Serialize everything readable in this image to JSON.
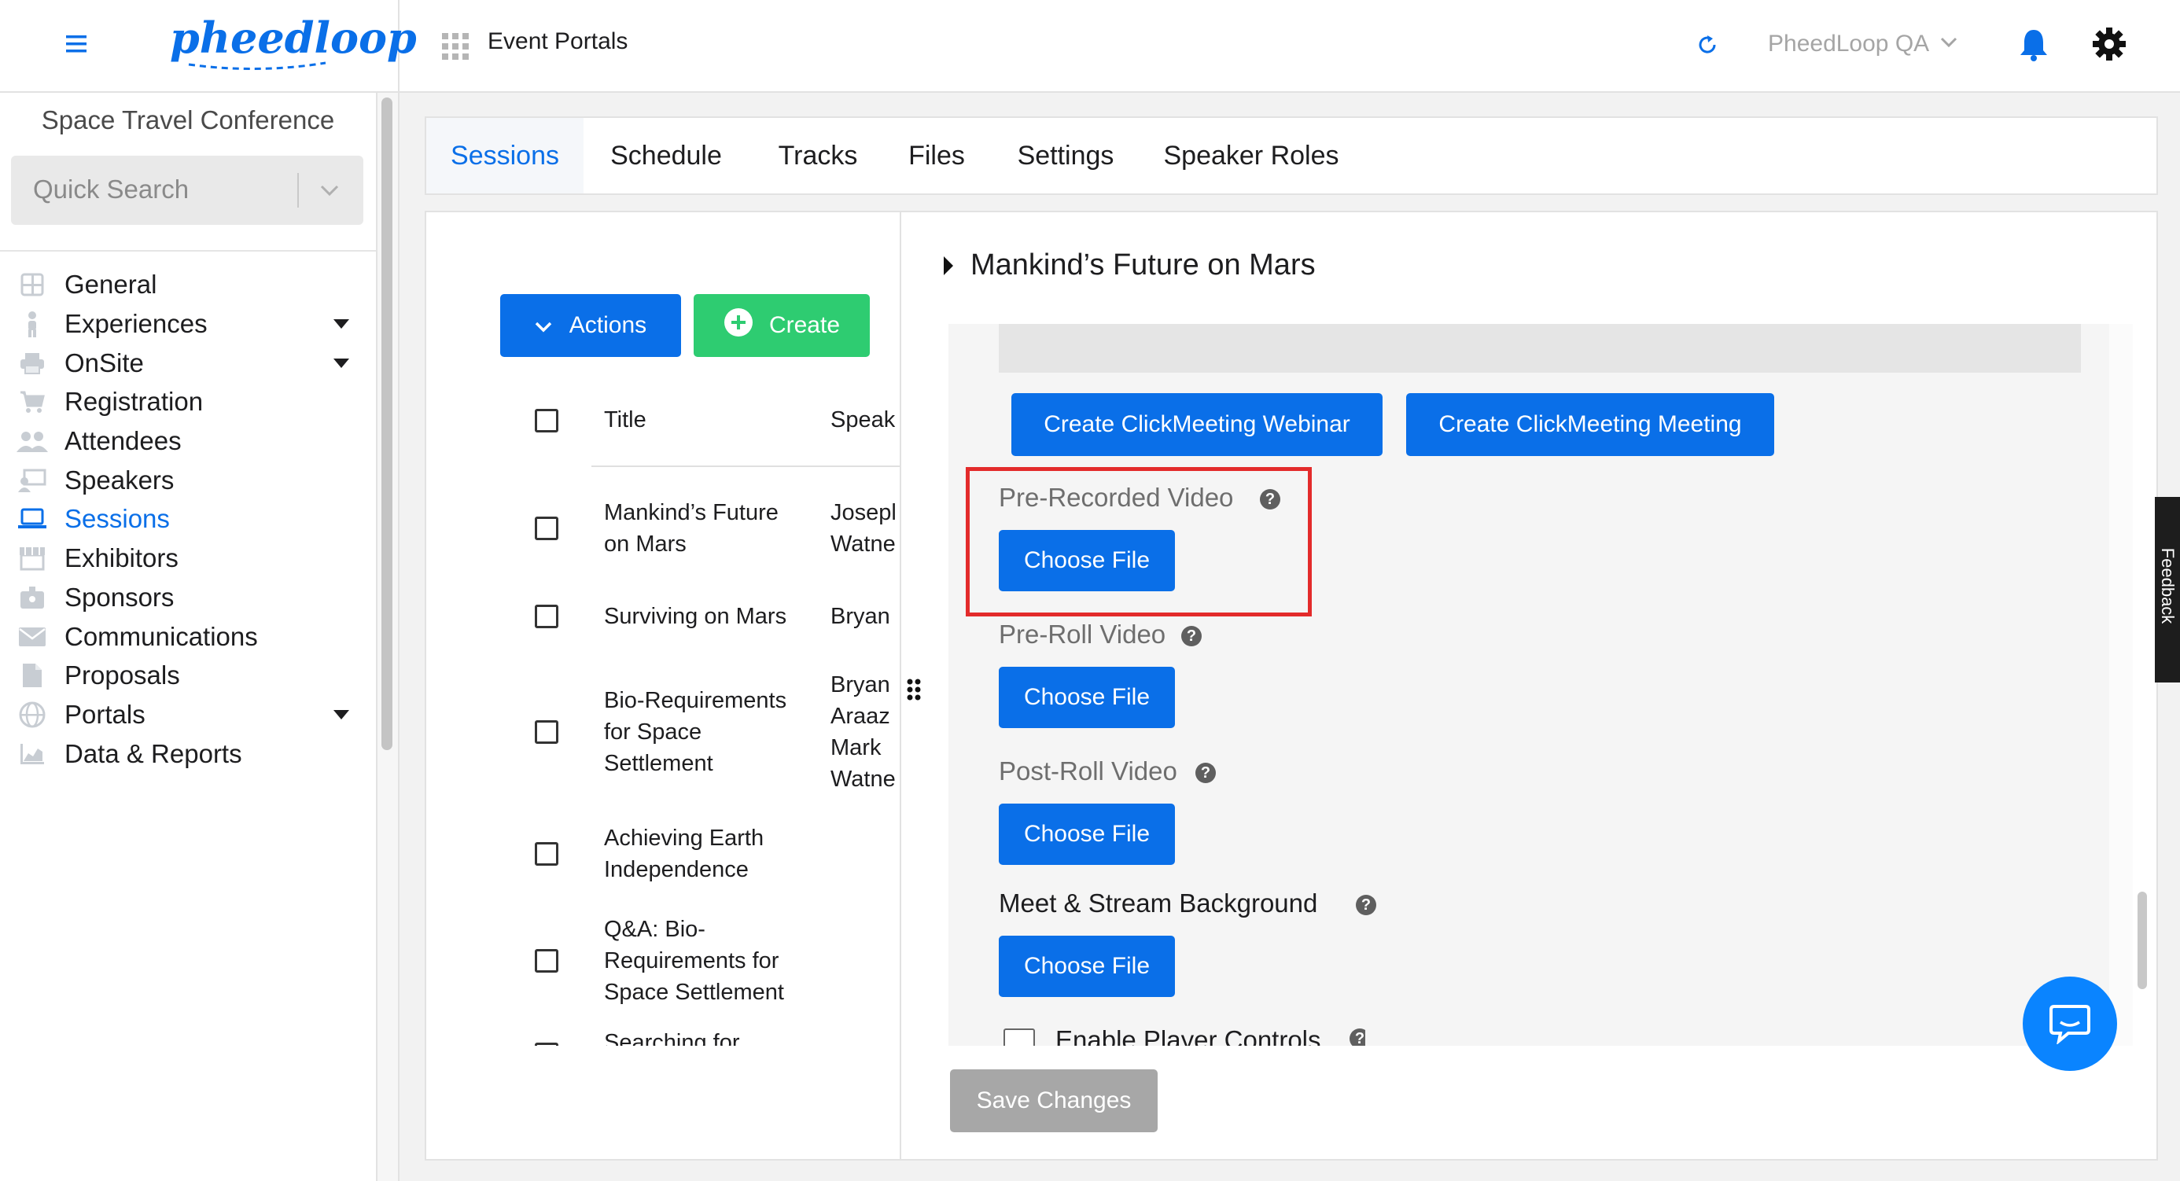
{
  "header": {
    "brand": "pheedloop",
    "section_title": "Event Portals",
    "account_name": "PheedLoop QA"
  },
  "sidebar": {
    "event_name": "Space Travel Conference",
    "search_placeholder": "Quick Search",
    "items": [
      {
        "label": "General",
        "icon": "grid-icon"
      },
      {
        "label": "Experiences",
        "icon": "person-icon",
        "has_caret": true
      },
      {
        "label": "OnSite",
        "icon": "printer-icon",
        "has_caret": true
      },
      {
        "label": "Registration",
        "icon": "cart-icon"
      },
      {
        "label": "Attendees",
        "icon": "people-icon"
      },
      {
        "label": "Speakers",
        "icon": "presenter-icon"
      },
      {
        "label": "Sessions",
        "icon": "laptop-icon",
        "active": true
      },
      {
        "label": "Exhibitors",
        "icon": "storefront-icon"
      },
      {
        "label": "Sponsors",
        "icon": "badge-icon"
      },
      {
        "label": "Communications",
        "icon": "envelope-icon"
      },
      {
        "label": "Proposals",
        "icon": "document-icon"
      },
      {
        "label": "Portals",
        "icon": "globe-icon",
        "has_caret": true
      },
      {
        "label": "Data & Reports",
        "icon": "chart-icon"
      }
    ]
  },
  "tabs": [
    "Sessions",
    "Schedule",
    "Tracks",
    "Files",
    "Settings",
    "Speaker Roles"
  ],
  "list": {
    "actions_label": "Actions",
    "create_label": "Create",
    "columns": [
      "Title",
      "Speak"
    ],
    "rows": [
      {
        "title": [
          "Mankind’s Future",
          "on Mars"
        ],
        "speaker": [
          "Josepl",
          "Watne"
        ]
      },
      {
        "title": [
          "Surviving on Mars"
        ],
        "speaker": [
          "Bryan"
        ]
      },
      {
        "title": [
          "Bio-Requirements",
          "for Space",
          "Settlement"
        ],
        "speaker": [
          "Bryan",
          "Araaz",
          "Mark",
          "Watne"
        ]
      },
      {
        "title": [
          "Achieving Earth",
          "Independence"
        ],
        "speaker": []
      },
      {
        "title": [
          "Q&A: Bio-",
          "Requirements for",
          "Space Settlement"
        ],
        "speaker": []
      },
      {
        "title": [
          "Searching for"
        ],
        "speaker": []
      }
    ]
  },
  "detail": {
    "session_title": "Mankind’s Future on Mars",
    "create_webinar_label": "Create ClickMeeting Webinar",
    "create_meeting_label": "Create ClickMeeting Meeting",
    "fields": [
      {
        "label": "Pre-Recorded Video",
        "button": "Choose File",
        "highlighted": true
      },
      {
        "label": "Pre-Roll Video",
        "button": "Choose File"
      },
      {
        "label": "Post-Roll Video",
        "button": "Choose File"
      },
      {
        "label": "Meet & Stream Background",
        "button": "Choose File"
      }
    ],
    "player_controls_label": "Enable Player Controls",
    "help_symbol": "?",
    "save_label": "Save Changes"
  },
  "feedback_tab_label": "Feedback",
  "colors": {
    "primary": "#0a6fe8",
    "create": "#2ecc71",
    "highlight_border": "#e32b2b",
    "disabled": "#a7a7a7"
  }
}
